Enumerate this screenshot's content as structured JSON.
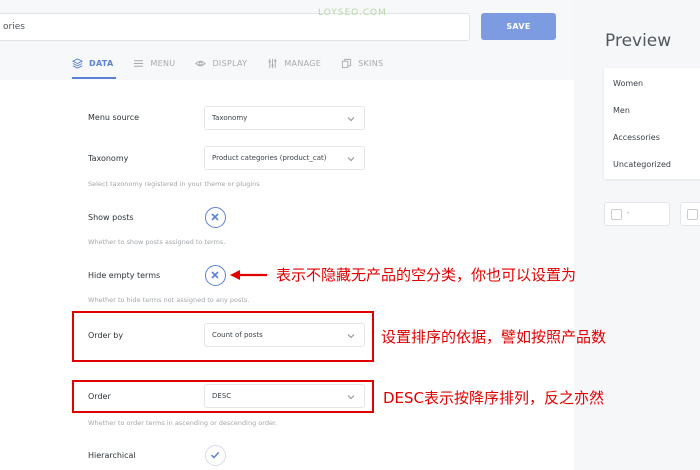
{
  "header": {
    "name_value": "ories",
    "save_label": "SAVE",
    "watermark": "LOYSEO.COM"
  },
  "tabs": [
    {
      "label": "DATA",
      "icon": "layers-icon",
      "active": true
    },
    {
      "label": "MENU",
      "icon": "menu-lines-icon",
      "active": false
    },
    {
      "label": "DISPLAY",
      "icon": "eye-icon",
      "active": false
    },
    {
      "label": "MANAGE",
      "icon": "sliders-icon",
      "active": false
    },
    {
      "label": "SKINS",
      "icon": "copy-icon",
      "active": false
    }
  ],
  "settings": {
    "menu_source": {
      "label": "Menu source",
      "value": "Taxonomy"
    },
    "taxonomy": {
      "label": "Taxonomy",
      "value": "Product categories (product_cat)",
      "help": "Select taxonomy registered in your theme or plugins"
    },
    "show_posts": {
      "label": "Show posts",
      "state": "off",
      "help": "Whether to show posts assigned to terms."
    },
    "hide_empty": {
      "label": "Hide empty terms",
      "state": "off",
      "help": "Whether to hide terms not assigned to any posts."
    },
    "order_by": {
      "label": "Order by",
      "value": "Count of posts"
    },
    "order": {
      "label": "Order",
      "value": "DESC",
      "help": "Whether to order terms in ascending or descending order."
    },
    "hierarchical": {
      "label": "Hierarchical",
      "state": "on"
    }
  },
  "annotations": {
    "hide_empty_note": "表示不隐藏无产品的空分类，你也可以设置为",
    "order_by_note": "设置排序的依据，譬如按照产品数",
    "order_note": "DESC表示按降序排列，反之亦然"
  },
  "preview": {
    "title": "Preview",
    "items": [
      "Women",
      "Men",
      "Accessories",
      "Uncategorized"
    ],
    "control_text": "-"
  },
  "colors": {
    "accent": "#5b82d6",
    "save_button": "#7c9be0",
    "annotation": "#e00000"
  }
}
